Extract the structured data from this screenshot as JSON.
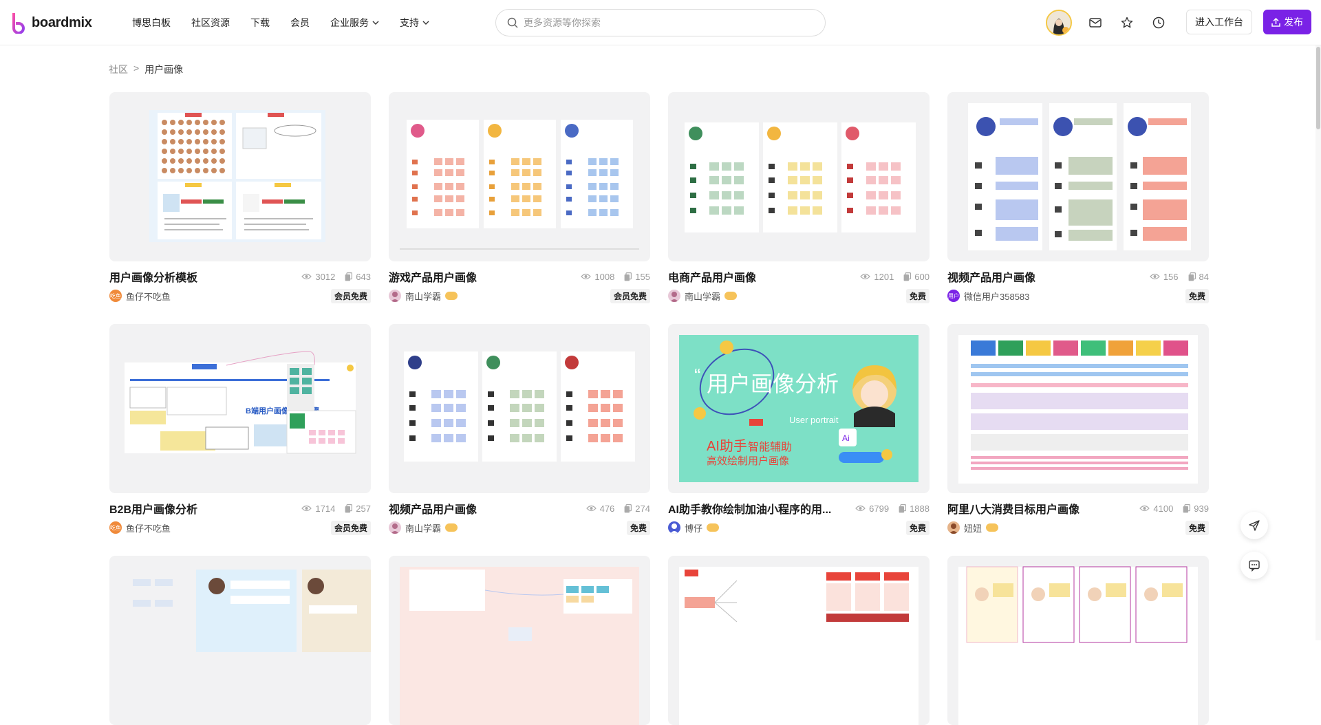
{
  "brand": {
    "name": "boardmix"
  },
  "nav": [
    {
      "label": "博思白板",
      "dropdown": false
    },
    {
      "label": "社区资源",
      "dropdown": false
    },
    {
      "label": "下载",
      "dropdown": false
    },
    {
      "label": "会员",
      "dropdown": false
    },
    {
      "label": "企业服务",
      "dropdown": true
    },
    {
      "label": "支持",
      "dropdown": true
    }
  ],
  "search": {
    "placeholder": "更多资源等你探索",
    "value": ""
  },
  "header_buttons": {
    "workspace": "进入工作台",
    "publish": "发布"
  },
  "breadcrumb": {
    "root": "社区",
    "separator": ">",
    "current": "用户画像"
  },
  "colors": {
    "accent": "#7a22e6",
    "tag_bg": "#f1f1f1"
  },
  "cards": [
    {
      "title": "用户画像分析模板",
      "views": "3012",
      "copies": "643",
      "author": "鱼仔不吃鱼",
      "avatar": "吃鱼",
      "avatar_color": "#f08a3a",
      "vip": false,
      "tag": "会员免费"
    },
    {
      "title": "游戏产品用户画像",
      "views": "1008",
      "copies": "155",
      "author": "南山学霸",
      "avatar": "",
      "avatar_color": "#e8c9d8",
      "vip": true,
      "tag": "会员免费"
    },
    {
      "title": "电商产品用户画像",
      "views": "1201",
      "copies": "600",
      "author": "南山学霸",
      "avatar": "",
      "avatar_color": "#e8c9d8",
      "vip": true,
      "tag": "免费"
    },
    {
      "title": "视频产品用户画像",
      "views": "156",
      "copies": "84",
      "author": "微信用户358583",
      "avatar": "用户",
      "avatar_color": "#7a22e6",
      "vip": false,
      "tag": "免费"
    },
    {
      "title": "B2B用户画像分析",
      "views": "1714",
      "copies": "257",
      "author": "鱼仔不吃鱼",
      "avatar": "吃鱼",
      "avatar_color": "#f08a3a",
      "vip": false,
      "tag": "会员免费"
    },
    {
      "title": "视频产品用户画像",
      "views": "476",
      "copies": "274",
      "author": "南山学霸",
      "avatar": "",
      "avatar_color": "#e8c9d8",
      "vip": true,
      "tag": "免费"
    },
    {
      "title": "AI助手教你绘制加油小程序的用...",
      "views": "6799",
      "copies": "1888",
      "author": "博仔",
      "avatar": "",
      "avatar_color": "#4a5bd4",
      "vip": true,
      "tag": "免费"
    },
    {
      "title": "阿里八大消费目标用户画像",
      "views": "4100",
      "copies": "939",
      "author": "妞妞",
      "avatar": "",
      "avatar_color": "#e6b48a",
      "vip": true,
      "tag": "免费"
    }
  ],
  "thumb_texts": {
    "ai_title": "用户画像分析",
    "ai_quote": "“",
    "ai_sub": "User portrait",
    "ai_line1a": "AI助手",
    "ai_line1b": "智能辅助",
    "ai_line2": "高效绘制用户画像",
    "ai_badge": "Ai",
    "b2b_title": "B端用户画像绘制步骤"
  }
}
